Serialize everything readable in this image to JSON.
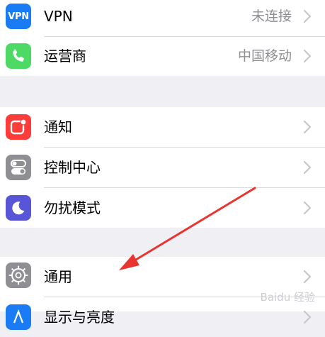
{
  "groups": [
    {
      "rows": [
        {
          "icon": "vpn-icon",
          "icon_text": "VPN",
          "label": "VPN",
          "value": "未连接"
        },
        {
          "icon": "phone-icon",
          "label": "运营商",
          "value": "中国移动"
        }
      ]
    },
    {
      "rows": [
        {
          "icon": "notifications-icon",
          "label": "通知"
        },
        {
          "icon": "control-center-icon",
          "label": "控制中心"
        },
        {
          "icon": "moon-icon",
          "label": "勿扰模式"
        }
      ]
    },
    {
      "rows": [
        {
          "icon": "gear-icon",
          "label": "通用"
        },
        {
          "icon": "display-icon",
          "label": "显示与亮度"
        }
      ]
    }
  ],
  "colors": {
    "vpn": "#1a7cf5",
    "phone": "#4cd964",
    "notifications": "#fc3d39",
    "control_center": "#8e8e93",
    "moon": "#5856d6",
    "gear": "#8e8e93",
    "display": "#1a7cf5",
    "annotation_arrow": "#e8352f"
  },
  "watermark": "Baidu 经验"
}
